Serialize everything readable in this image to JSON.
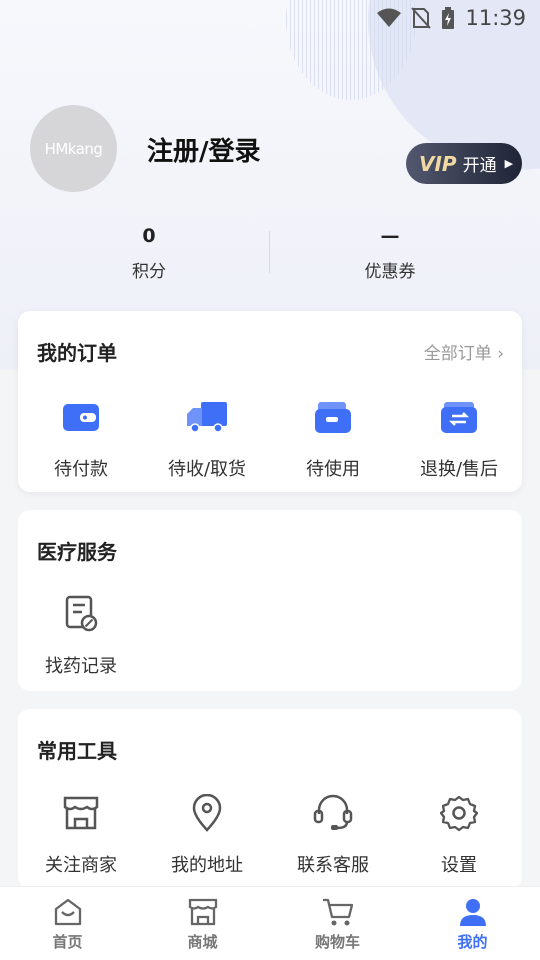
{
  "status_bar": {
    "time": "11:39"
  },
  "profile": {
    "avatar_text": "HMkang",
    "login_title": "注册/登录",
    "vip": {
      "badge": "VIP",
      "label": "开通"
    }
  },
  "stats": [
    {
      "value": "0",
      "label": "积分"
    },
    {
      "value": "—",
      "label": "优惠券"
    }
  ],
  "orders": {
    "title": "我的订单",
    "more": "全部订单",
    "items": [
      {
        "label": "待付款",
        "icon": "wallet-icon"
      },
      {
        "label": "待收/取货",
        "icon": "truck-icon"
      },
      {
        "label": "待使用",
        "icon": "card-wallet-icon"
      },
      {
        "label": "退换/售后",
        "icon": "exchange-icon"
      }
    ]
  },
  "medical": {
    "title": "医疗服务",
    "items": [
      {
        "label": "找药记录",
        "icon": "prescription-record-icon"
      }
    ]
  },
  "tools": {
    "title": "常用工具",
    "items": [
      {
        "label": "关注商家",
        "icon": "store-icon"
      },
      {
        "label": "我的地址",
        "icon": "location-pin-icon"
      },
      {
        "label": "联系客服",
        "icon": "headset-icon"
      },
      {
        "label": "设置",
        "icon": "gear-icon"
      }
    ]
  },
  "tabbar": {
    "active": "我的",
    "accent_color": "#3e6ff6",
    "items": [
      {
        "label": "首页",
        "icon": "home-icon"
      },
      {
        "label": "商城",
        "icon": "shop-icon"
      },
      {
        "label": "购物车",
        "icon": "cart-icon"
      },
      {
        "label": "我的",
        "icon": "user-icon"
      }
    ]
  }
}
